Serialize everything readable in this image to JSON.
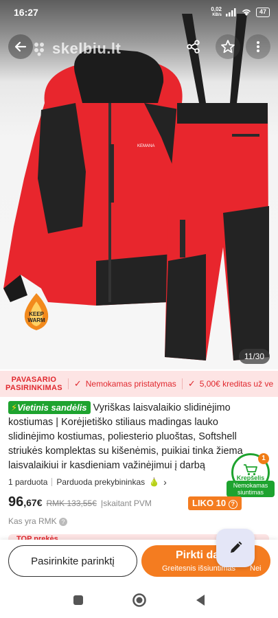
{
  "status_bar": {
    "time": "16:27",
    "net_speed": "0,02",
    "net_unit": "KB/s",
    "battery": "47"
  },
  "header": {
    "logo_text": "skelbiu.lt"
  },
  "icons": {
    "back": "arrow-left-icon",
    "share": "share-icon",
    "favorite": "star-icon",
    "more": "more-vertical-icon",
    "logo": "skelbiu-logo-icon",
    "keep_warm": "keep-warm-badge",
    "cart": "cart-icon",
    "edit": "pencil-icon",
    "nav_recent": "square-icon",
    "nav_home": "circle-icon",
    "nav_back": "triangle-back-icon"
  },
  "gallery": {
    "keep_warm_line1": "KEEP",
    "keep_warm_line2": "WARM",
    "counter": "11/30"
  },
  "promo": {
    "title_line1": "PAVASARIO",
    "title_line2": "PASIRINKIMAS",
    "items": [
      "Nemokamas pristatymas",
      "5,00€ kreditas už ve"
    ]
  },
  "product": {
    "warehouse_badge": "Vietinis sandėlis",
    "title_lines": [
      "Vyriškas laisvalaikio slidinėjimo",
      "kostiumas | Korėjietiško stiliaus madingas lauko",
      "slidinėjimo kostiumas, poliesterio pluoštas, Softshell",
      "striukės komplektas su kišenėmis, puikiai tinka žiema",
      "laisvalaikiui ir kasdieniam važinėjimui į darbą"
    ],
    "sold": "1 parduota",
    "seller": "Parduoda prekybininkas",
    "price_int": "96",
    "price_dec": ",67€",
    "price_old": "RMK 133,55€",
    "vat_note": "Įskaitant PVM",
    "stock": "LIKO 10",
    "rmk_question": "Kas yra RMK",
    "top_strip": "TOP prekės"
  },
  "cart": {
    "count": "1",
    "label": "Krepšelis",
    "shipping": "Nemokamas siuntimas"
  },
  "actions": {
    "select_label": "Pasirinkite parinktį",
    "buy_label": "Pirkti da",
    "buy_sub": "Greitesnis išsiuntimas",
    "buy_sub2": "Nei"
  },
  "colors": {
    "accent_orange": "#f47c20",
    "green": "#1ea32f",
    "promo_red": "#e0282e",
    "promo_bg": "#fde4e4"
  }
}
